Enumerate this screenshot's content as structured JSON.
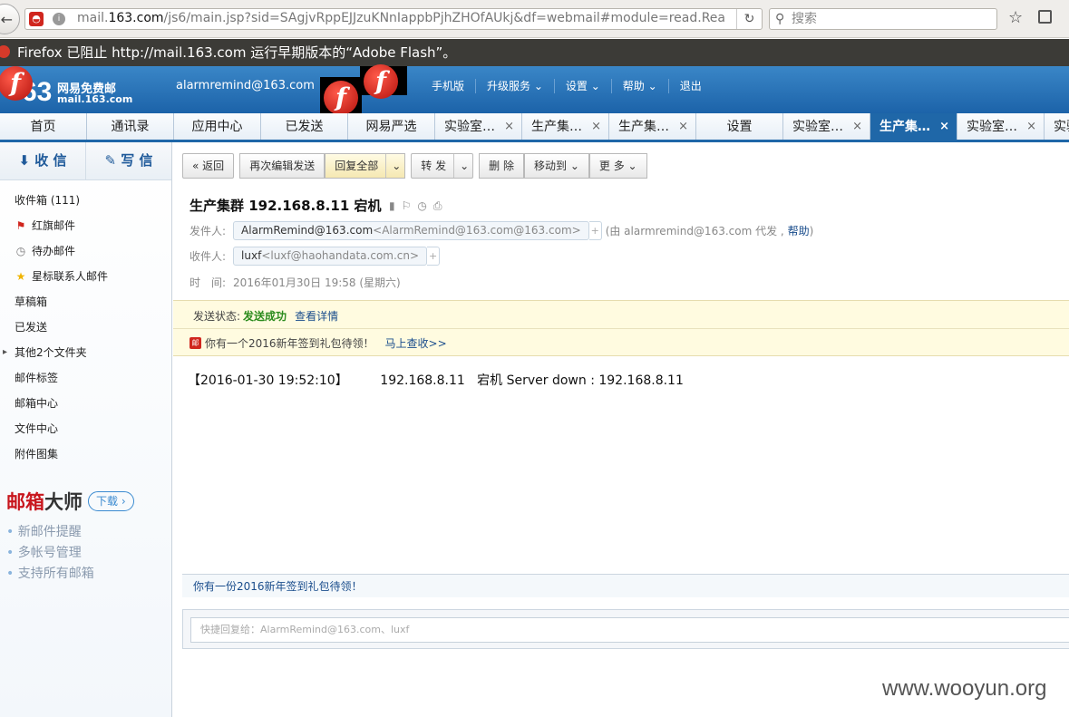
{
  "browser": {
    "url": "mail.163.com/js6/main.jsp?sid=SAgjvRppEJJzuKNnIappbPjhZHOfAUkj&df=webmail#module=read.Rea",
    "url_host": "mail.163.com",
    "url_rest": "/js6/main.jsp?sid=SAgjvRppEJJzuKNnIappbPjhZHOfAUkj&df=webmail#module=read.Rea",
    "url_scheme_hidden": "mail.",
    "search_placeholder": "搜索",
    "flash_warning": "Firefox 已阻止 http://mail.163.com 运行早期版本的“Adobe Flash”。",
    "icons": [
      "back-icon",
      "site-icon",
      "info-icon",
      "reload-icon",
      "search-icon",
      "bookmark-star-icon",
      "library-icon",
      "flash-stop-icon"
    ]
  },
  "header": {
    "logo_number": "63",
    "logo_title": "网易免费邮",
    "logo_domain": "mail.163.com",
    "account": "alarmremind@163.com",
    "nav": [
      "手机版",
      "升级服务",
      "设置",
      "帮助",
      "退出"
    ],
    "brand_color": "#1f67a8"
  },
  "tabs": [
    {
      "label": "首页"
    },
    {
      "label": "通讯录"
    },
    {
      "label": "应用中心"
    },
    {
      "label": "已发送"
    },
    {
      "label": "网易严选"
    },
    {
      "label": "实验室…",
      "closable": true
    },
    {
      "label": "生产集…",
      "closable": true
    },
    {
      "label": "生产集…",
      "closable": true
    },
    {
      "label": "设置"
    },
    {
      "label": "实验室…",
      "closable": true
    },
    {
      "label": "生产集…",
      "closable": true,
      "active": true
    },
    {
      "label": "实验室…",
      "closable": true
    },
    {
      "label": "实验"
    }
  ],
  "sidebar": {
    "receive": "收 信",
    "write": "写 信",
    "folders": [
      {
        "label": "收件箱 (111)",
        "icon": ""
      },
      {
        "label": "红旗邮件",
        "icon": "red-flag-icon"
      },
      {
        "label": "待办邮件",
        "icon": "clock-icon"
      },
      {
        "label": "星标联系人邮件",
        "icon": "star-icon"
      },
      {
        "label": "草稿箱",
        "icon": ""
      },
      {
        "label": "已发送",
        "icon": ""
      },
      {
        "label": "其他2个文件夹",
        "icon": ""
      },
      {
        "label": "邮件标签",
        "icon": ""
      },
      {
        "label": "邮箱中心",
        "icon": ""
      },
      {
        "label": "文件中心",
        "icon": ""
      },
      {
        "label": "附件图集",
        "icon": ""
      }
    ],
    "promo_red": "邮箱",
    "promo_black": "大师",
    "promo_red_first": "邮",
    "promo_download": "下载",
    "promo_items": [
      "新邮件提醒",
      "多帐号管理",
      "支持所有邮箱"
    ]
  },
  "toolbar": {
    "back": "返回",
    "reedit": "再次编辑发送",
    "reply_all": "回复全部",
    "forward": "转 发",
    "delete": "删 除",
    "move_to": "移动到",
    "more": "更 多"
  },
  "mail": {
    "subject": "生产集群 192.168.8.11 宕机",
    "from_label": "发件人:",
    "from_name": "AlarmRemind@163.com",
    "from_addr": "<AlarmRemind@163.com@163.com>",
    "proxy_note": "(由 alarmremind@163.com 代发 ,",
    "help": "帮助",
    "proxy_close": ")",
    "to_label": "收件人:",
    "to_name": "luxf",
    "to_addr": "<luxf@haohandata.com.cn>",
    "time_label": "时　间:",
    "time": "2016年01月30日 19:58 (星期六)",
    "status_label": "发送状态:",
    "status_value": "发送成功",
    "status_link": "查看详情",
    "gift_text": "你有一个2016新年签到礼包待领！",
    "gift_link": "马上查收>>",
    "body": "【2016-01-30 19:52:10】        192.168.8.11   宕机 Server down : 192.168.8.11",
    "bottom_gift": "你有一份2016新年签到礼包待领！",
    "quick_reply_placeholder": "快捷回复给：AlarmRemind@163.com、luxf"
  },
  "watermark": "www.wooyun.org"
}
